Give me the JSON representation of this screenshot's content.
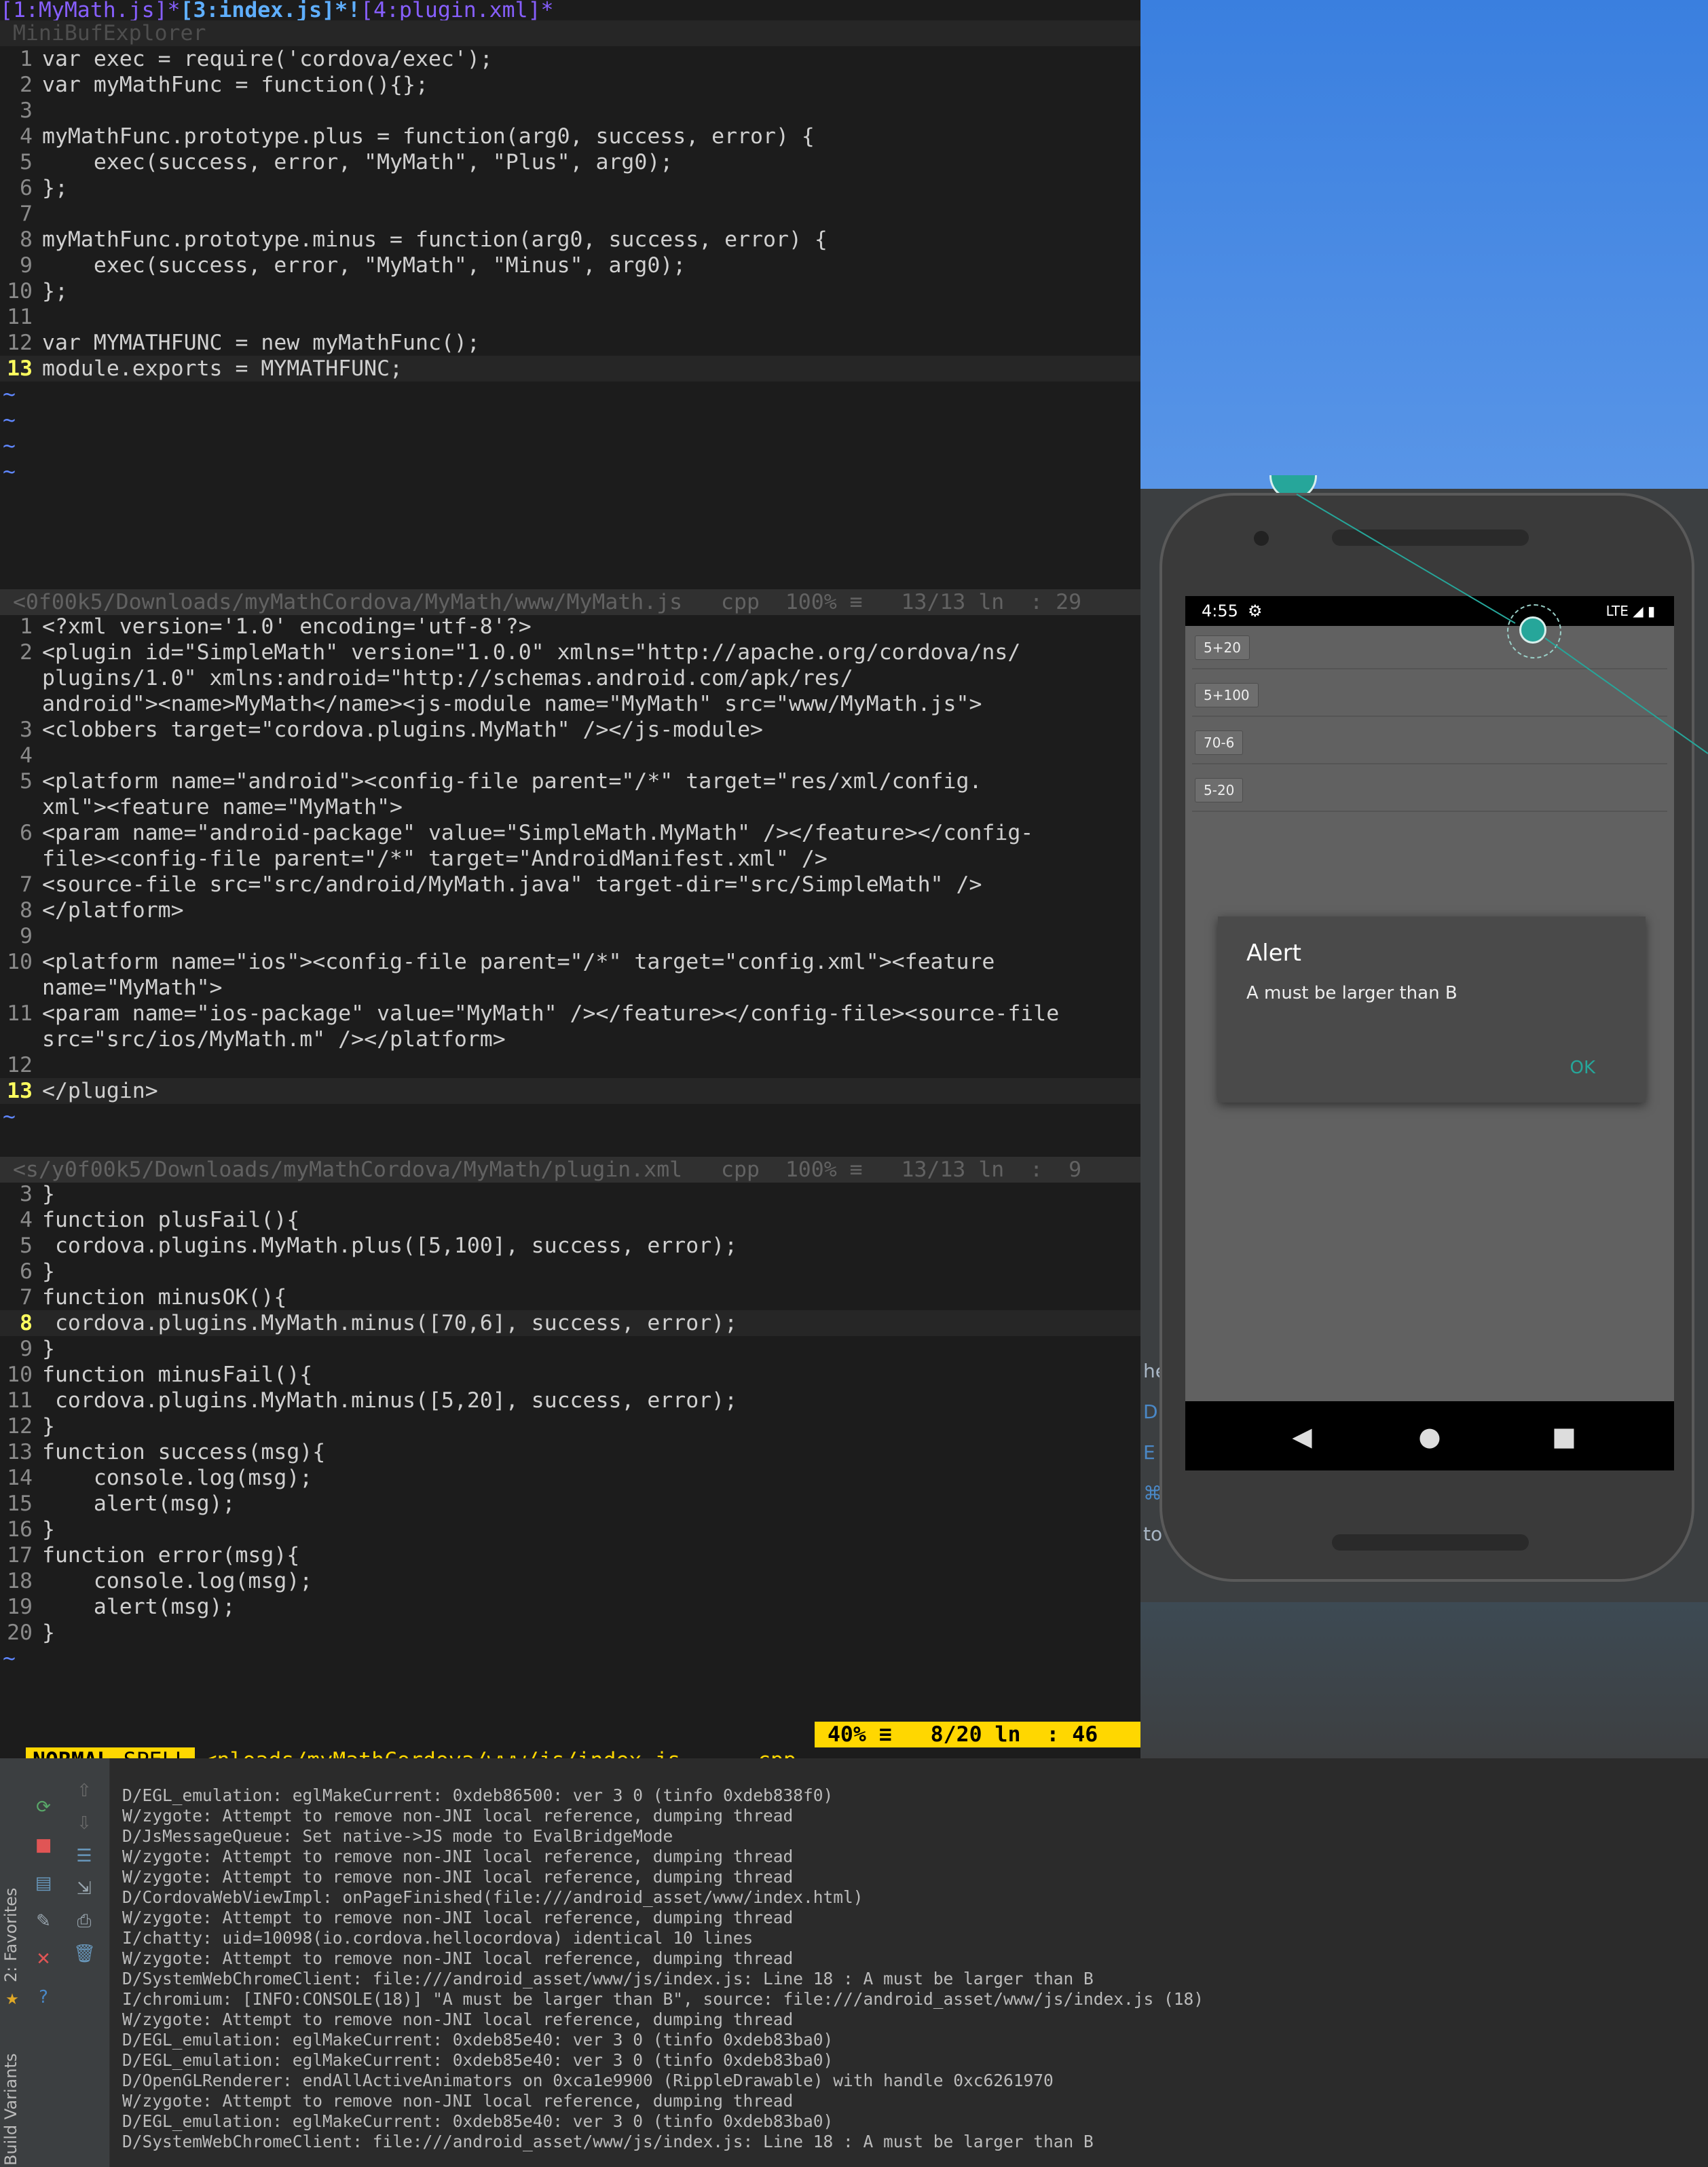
{
  "vim": {
    "tabline": {
      "tab1": "[1:MyMath.js]*",
      "tab2": "[3:index.js]*!",
      "tab3": "[4:plugin.xml]*"
    },
    "minibuf_label": "MiniBufExplorer",
    "pane1": {
      "lines": [
        {
          "n": "1",
          "t": "var exec = require('cordova/exec');"
        },
        {
          "n": "2",
          "t": "var myMathFunc = function(){};"
        },
        {
          "n": "3",
          "t": ""
        },
        {
          "n": "4",
          "t": "myMathFunc.prototype.plus = function(arg0, success, error) {"
        },
        {
          "n": "5",
          "t": "    exec(success, error, \"MyMath\", \"Plus\", arg0);"
        },
        {
          "n": "6",
          "t": "};"
        },
        {
          "n": "7",
          "t": ""
        },
        {
          "n": "8",
          "t": "myMathFunc.prototype.minus = function(arg0, success, error) {"
        },
        {
          "n": "9",
          "t": "    exec(success, error, \"MyMath\", \"Minus\", arg0);"
        },
        {
          "n": "10",
          "t": "};"
        },
        {
          "n": "11",
          "t": ""
        },
        {
          "n": "12",
          "t": "var MYMATHFUNC = new myMathFunc();"
        },
        {
          "n": "13",
          "t": "module.exports = MYMATHFUNC;"
        }
      ],
      "statusline": "<0f00k5/Downloads/myMathCordova/MyMath/www/MyMath.js   cpp  100% ≡   13/13 ln  : 29"
    },
    "pane2": {
      "lines": [
        {
          "n": "1",
          "t": "<?xml version='1.0' encoding='utf-8'?>"
        },
        {
          "n": "2",
          "t": "<plugin id=\"SimpleMath\" version=\"1.0.0\" xmlns=\"http://apache.org/cordova/ns/"
        },
        {
          "n": "",
          "t": "plugins/1.0\" xmlns:android=\"http://schemas.android.com/apk/res/"
        },
        {
          "n": "",
          "t": "android\"><name>MyMath</name><js-module name=\"MyMath\" src=\"www/MyMath.js\">"
        },
        {
          "n": "3",
          "t": "<clobbers target=\"cordova.plugins.MyMath\" /></js-module>"
        },
        {
          "n": "4",
          "t": ""
        },
        {
          "n": "5",
          "t": "<platform name=\"android\"><config-file parent=\"/*\" target=\"res/xml/config."
        },
        {
          "n": "",
          "t": "xml\"><feature name=\"MyMath\">"
        },
        {
          "n": "6",
          "t": "<param name=\"android-package\" value=\"SimpleMath.MyMath\" /></feature></config-"
        },
        {
          "n": "",
          "t": "file><config-file parent=\"/*\" target=\"AndroidManifest.xml\" />"
        },
        {
          "n": "7",
          "t": "<source-file src=\"src/android/MyMath.java\" target-dir=\"src/SimpleMath\" />"
        },
        {
          "n": "8",
          "t": "</platform>"
        },
        {
          "n": "9",
          "t": ""
        },
        {
          "n": "10",
          "t": "<platform name=\"ios\"><config-file parent=\"/*\" target=\"config.xml\"><feature"
        },
        {
          "n": "",
          "t": "name=\"MyMath\">"
        },
        {
          "n": "11",
          "t": "<param name=\"ios-package\" value=\"MyMath\" /></feature></config-file><source-file"
        },
        {
          "n": "",
          "t": "src=\"src/ios/MyMath.m\" /></platform>"
        },
        {
          "n": "12",
          "t": ""
        },
        {
          "n": "13",
          "t": "</plugin>"
        }
      ],
      "statusline": "<s/y0f00k5/Downloads/myMathCordova/MyMath/plugin.xml   cpp  100% ≡   13/13 ln  :  9"
    },
    "pane3": {
      "lines": [
        {
          "n": "3",
          "t": "}"
        },
        {
          "n": "4",
          "t": "function plusFail(){"
        },
        {
          "n": "5",
          "t": " cordova.plugins.MyMath.plus([5,100], success, error);"
        },
        {
          "n": "6",
          "t": "}"
        },
        {
          "n": "7",
          "t": "function minusOK(){"
        },
        {
          "n": "8",
          "t": " cordova.plugins.MyMath.minus([70,6], success, error);"
        },
        {
          "n": "9",
          "t": "}"
        },
        {
          "n": "10",
          "t": "function minusFail(){"
        },
        {
          "n": "11",
          "t": " cordova.plugins.MyMath.minus([5,20], success, error);"
        },
        {
          "n": "12",
          "t": "}"
        },
        {
          "n": "13",
          "t": "function success(msg){"
        },
        {
          "n": "14",
          "t": "    console.log(msg);"
        },
        {
          "n": "15",
          "t": "    alert(msg);"
        },
        {
          "n": "16",
          "t": "}"
        },
        {
          "n": "17",
          "t": "function error(msg){"
        },
        {
          "n": "18",
          "t": "    console.log(msg);"
        },
        {
          "n": "19",
          "t": "    alert(msg);"
        },
        {
          "n": "20",
          "t": "}"
        }
      ]
    },
    "status": {
      "mode": "NORMAL",
      "spell": "SPELL",
      "file": "<nloads/myMathCordova/www/js/index.js",
      "filetype": "cpp",
      "position": " 40% ≡   8/20 ln  : 46"
    }
  },
  "host_partial_text": [
    "he",
    "D",
    "E",
    "⌘",
    "to op"
  ],
  "logcat": {
    "tab_favorites": "2: Favorites",
    "tab_build_variants": "Build Variants",
    "lines": [
      "D/EGL_emulation: eglMakeCurrent: 0xdeb86500: ver 3 0 (tinfo 0xdeb838f0)",
      "W/zygote: Attempt to remove non-JNI local reference, dumping thread",
      "D/JsMessageQueue: Set native->JS mode to EvalBridgeMode",
      "W/zygote: Attempt to remove non-JNI local reference, dumping thread",
      "W/zygote: Attempt to remove non-JNI local reference, dumping thread",
      "D/CordovaWebViewImpl: onPageFinished(file:///android_asset/www/index.html)",
      "W/zygote: Attempt to remove non-JNI local reference, dumping thread",
      "I/chatty: uid=10098(io.cordova.hellocordova) identical 10 lines",
      "W/zygote: Attempt to remove non-JNI local reference, dumping thread",
      "D/SystemWebChromeClient: file:///android_asset/www/js/index.js: Line 18 : A must be larger than B",
      "I/chromium: [INFO:CONSOLE(18)] \"A must be larger than B\", source: file:///android_asset/www/js/index.js (18)",
      "W/zygote: Attempt to remove non-JNI local reference, dumping thread",
      "D/EGL_emulation: eglMakeCurrent: 0xdeb85e40: ver 3 0 (tinfo 0xdeb83ba0)",
      "D/EGL_emulation: eglMakeCurrent: 0xdeb85e40: ver 3 0 (tinfo 0xdeb83ba0)",
      "D/OpenGLRenderer: endAllActiveAnimators on 0xca1e9900 (RippleDrawable) with handle 0xc6261970",
      "W/zygote: Attempt to remove non-JNI local reference, dumping thread",
      "D/EGL_emulation: eglMakeCurrent: 0xdeb85e40: ver 3 0 (tinfo 0xdeb83ba0)",
      "D/SystemWebChromeClient: file:///android_asset/www/js/index.js: Line 18 : A must be larger than B"
    ]
  },
  "phone": {
    "time": "4:55",
    "signal": "LTE ◢ ▮",
    "buttons": [
      "5+20",
      "5+100",
      "70-6",
      "5-20"
    ],
    "dialog": {
      "title": "Alert",
      "message": "A must be larger than B",
      "ok": "OK"
    },
    "accent": "#26a69a"
  }
}
